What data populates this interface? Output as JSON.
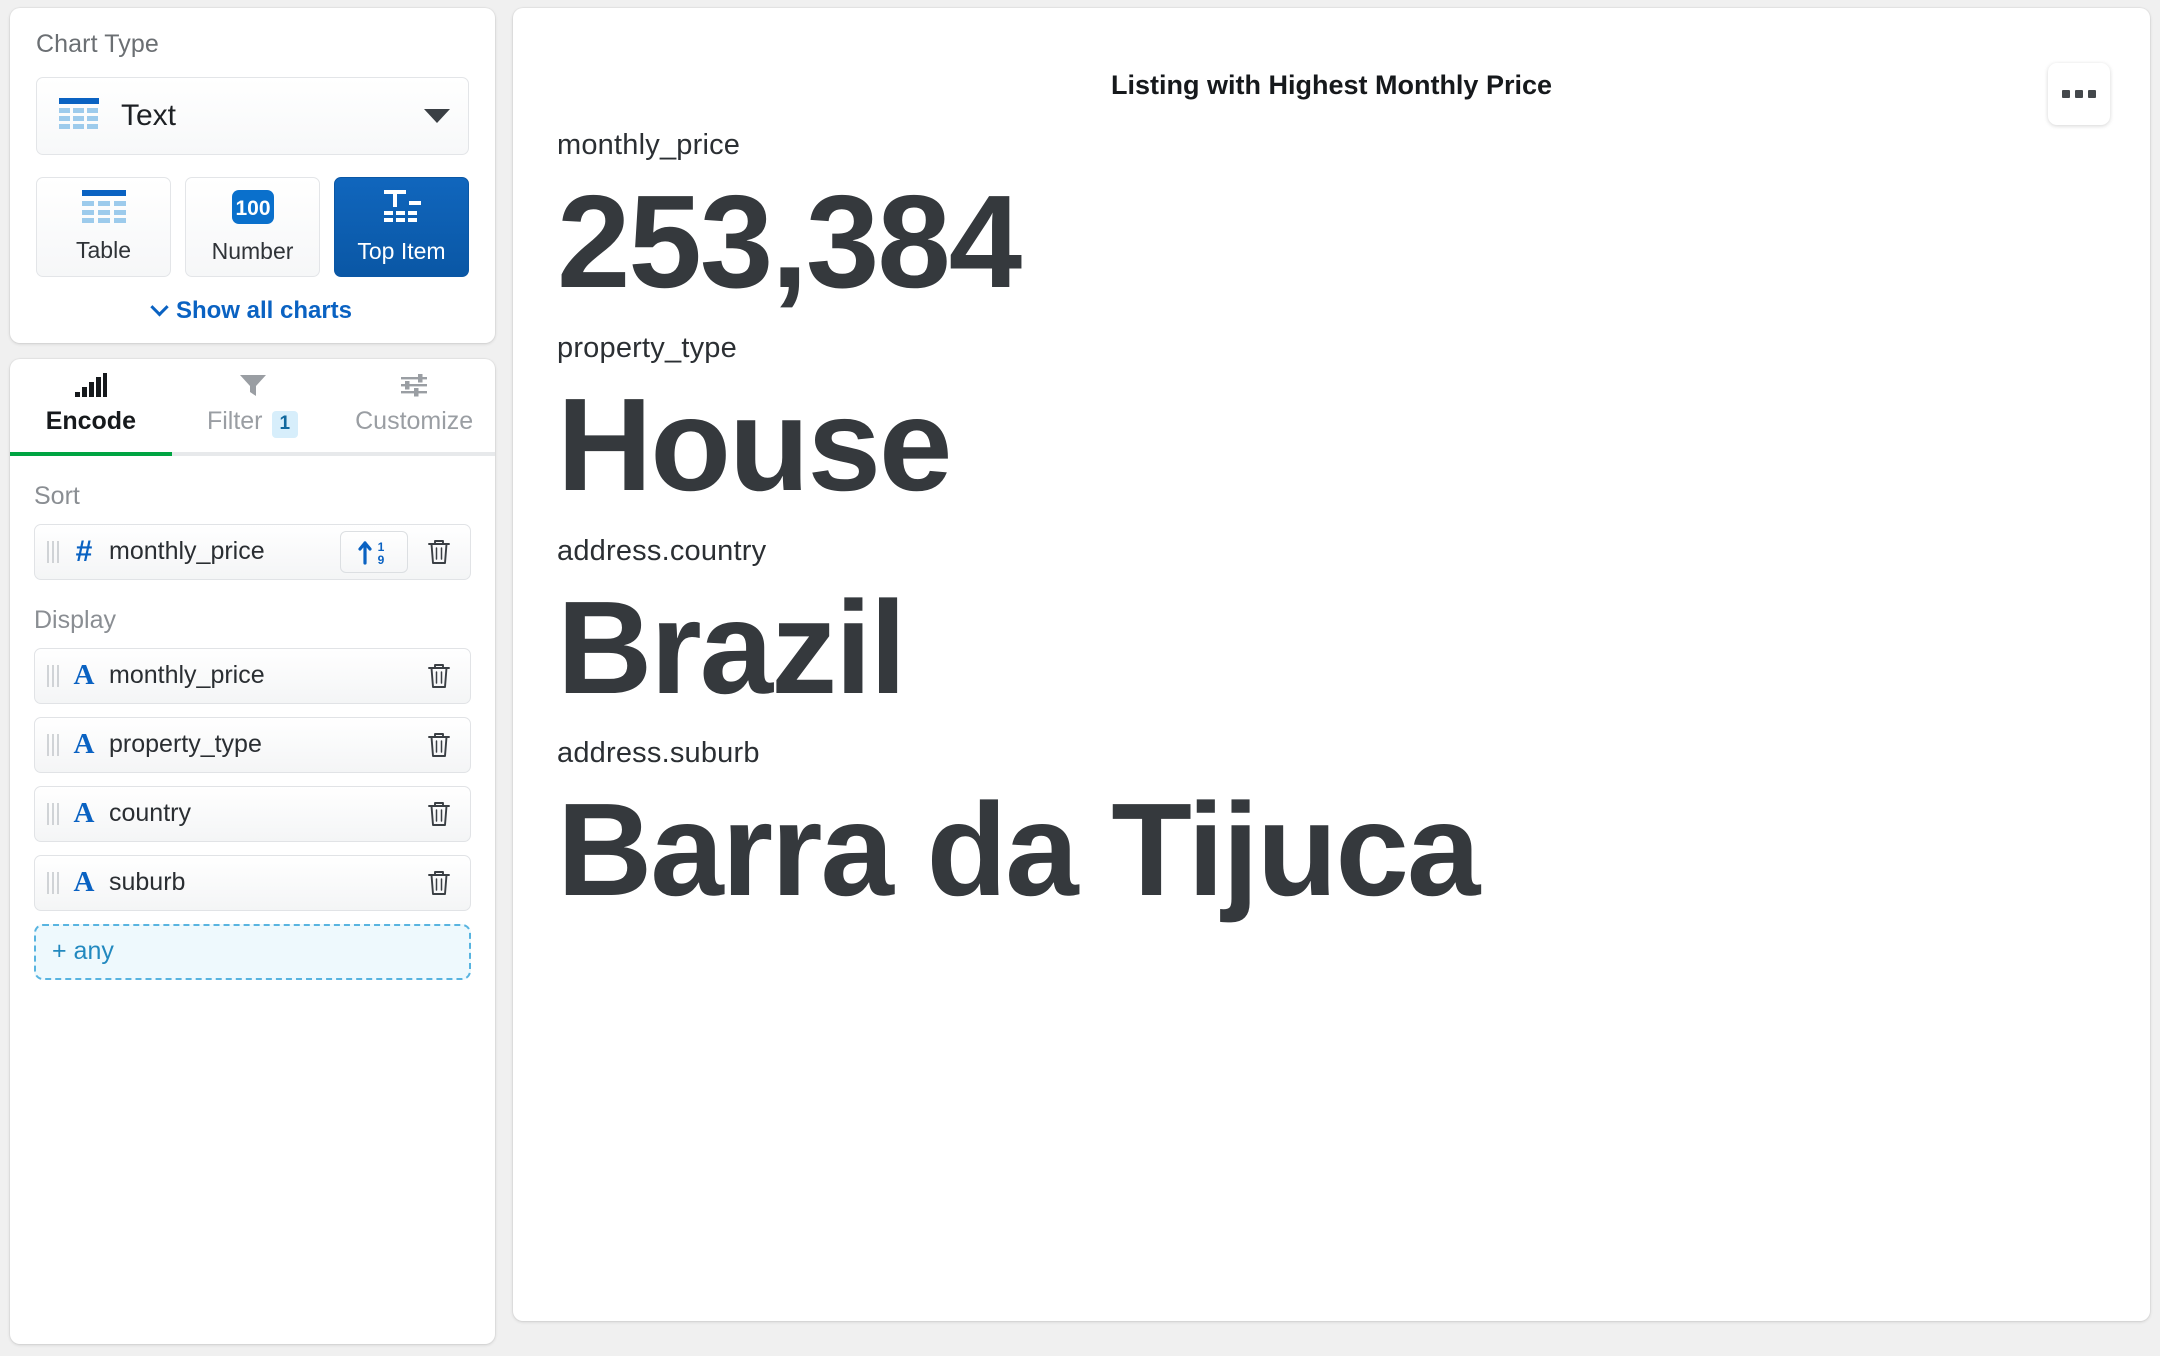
{
  "sidebar": {
    "chart_type": {
      "section_label": "Chart Type",
      "selected": "Text",
      "selected_icon": "table-icon",
      "dropdown_icon": "caret-down-icon",
      "buttons": [
        {
          "label": "Table",
          "icon": "table-icon",
          "active": false
        },
        {
          "label": "Number",
          "icon": "number-100-icon",
          "active": false
        },
        {
          "label": "Top Item",
          "icon": "top-item-icon",
          "active": true
        }
      ],
      "show_all_label": "Show all charts",
      "show_all_icon": "chevron-down-icon"
    },
    "tabs": [
      {
        "label": "Encode",
        "icon": "bar-chart-icon",
        "active": true,
        "badge": null
      },
      {
        "label": "Filter",
        "icon": "funnel-icon",
        "active": false,
        "badge": "1"
      },
      {
        "label": "Customize",
        "icon": "sliders-icon",
        "active": false,
        "badge": null
      }
    ],
    "encode": {
      "sort": {
        "label": "Sort",
        "fields": [
          {
            "name": "monthly_price",
            "type_icon": "number-field-icon",
            "type_glyph": "#",
            "sort_icon": "sort-ascending-numeric-icon",
            "delete_icon": "trash-icon",
            "drag_icon": "drag-handle-icon"
          }
        ]
      },
      "display": {
        "label": "Display",
        "fields": [
          {
            "name": "monthly_price",
            "type_icon": "text-field-icon",
            "type_glyph": "A",
            "delete_icon": "trash-icon",
            "drag_icon": "drag-handle-icon"
          },
          {
            "name": "property_type",
            "type_icon": "text-field-icon",
            "type_glyph": "A",
            "delete_icon": "trash-icon",
            "drag_icon": "drag-handle-icon"
          },
          {
            "name": "country",
            "type_icon": "text-field-icon",
            "type_glyph": "A",
            "delete_icon": "trash-icon",
            "drag_icon": "drag-handle-icon"
          },
          {
            "name": "suburb",
            "type_icon": "text-field-icon",
            "type_glyph": "A",
            "delete_icon": "trash-icon",
            "drag_icon": "drag-handle-icon"
          }
        ],
        "add_label": "+ any"
      }
    }
  },
  "main": {
    "title": "Listing with Highest Monthly Price",
    "more_icon": "ellipsis-icon",
    "fields": [
      {
        "label": "monthly_price",
        "value": "253,384"
      },
      {
        "label": "property_type",
        "value": "House"
      },
      {
        "label": "address.country",
        "value": "Brazil"
      },
      {
        "label": "address.suburb",
        "value": "Barra da Tijuca"
      }
    ]
  },
  "colors": {
    "accent_blue": "#0a62c2",
    "active_button": "#0a57a5",
    "tab_underline_green": "#00a442",
    "badge_bg": "#d7eefb",
    "badge_text": "#11689e",
    "add_dashed_border": "#58b4e0",
    "value_text": "#35393d"
  },
  "chart_data": {
    "type": "table",
    "title": "Listing with Highest Monthly Price",
    "categories": [
      "monthly_price",
      "property_type",
      "address.country",
      "address.suburb"
    ],
    "values": [
      "253,384",
      "House",
      "Brazil",
      "Barra da Tijuca"
    ],
    "sort_by": "monthly_price",
    "sort_direction": "ascending",
    "filters_applied": 1,
    "display_fields": [
      "monthly_price",
      "property_type",
      "country",
      "suburb"
    ]
  }
}
